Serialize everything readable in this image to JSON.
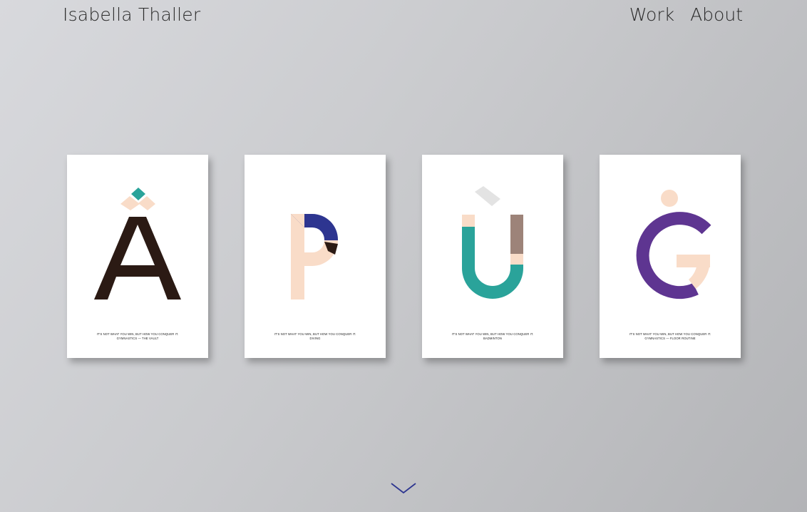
{
  "header": {
    "site_title": "Isabella Thaller",
    "nav": [
      {
        "label": "Work"
      },
      {
        "label": "About"
      }
    ]
  },
  "posters": [
    {
      "letter": "Â",
      "caption_line1": "IT'S NOT WHAT YOU WIN, BUT HOW YOU CONQUER IT.",
      "caption_line2": "GYMNASTICS — THE VAULT"
    },
    {
      "letter": "P",
      "caption_line1": "IT'S NOT WHAT YOU WIN, BUT HOW YOU CONQUER IT.",
      "caption_line2": "DIVING"
    },
    {
      "letter": "Ù",
      "caption_line1": "IT'S NOT WHAT YOU WIN, BUT HOW YOU CONQUER IT.",
      "caption_line2": "BADMINTON"
    },
    {
      "letter": "Ġ",
      "caption_line1": "IT'S NOT WHAT YOU WIN, BUT HOW YOU CONQUER IT.",
      "caption_line2": "GYMNASTICS — FLOOR ROUTINE"
    }
  ],
  "colors": {
    "dark_brown": "#2b1a14",
    "peach": "#f9dcc8",
    "teal": "#2aa39a",
    "navy": "#2d3590",
    "taupe": "#9d8379",
    "purple": "#5e3591",
    "light_gray": "#e3e3e3",
    "chevron": "#2d3590"
  },
  "scroll_icon": "chevron-down-icon"
}
